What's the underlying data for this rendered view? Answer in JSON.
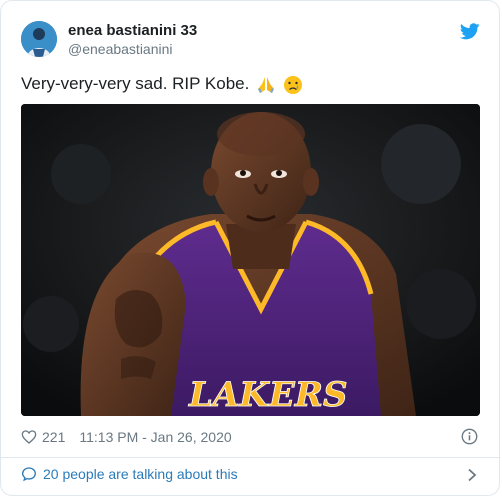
{
  "author": {
    "name": "enea bastianini 33",
    "handle": "@eneabastianini"
  },
  "tweet": {
    "text": "Very-very-very sad. RIP Kobe.",
    "emojis": [
      "folded-hands",
      "crying-face"
    ],
    "photo_jersey_text": "LAKERS"
  },
  "meta": {
    "likes": "221",
    "timestamp": "11:13 PM - Jan 26, 2020"
  },
  "footer": {
    "talking": "20 people are talking about this"
  },
  "colors": {
    "twitter_blue": "#1da1f2",
    "link_blue": "#2b7bb9",
    "text_gray": "#697882",
    "lakers_purple": "#552583",
    "lakers_gold": "#fdb927"
  },
  "icons": [
    "twitter-bird-icon",
    "heart-icon",
    "info-icon",
    "speech-bubble-icon",
    "chevron-right-icon"
  ]
}
